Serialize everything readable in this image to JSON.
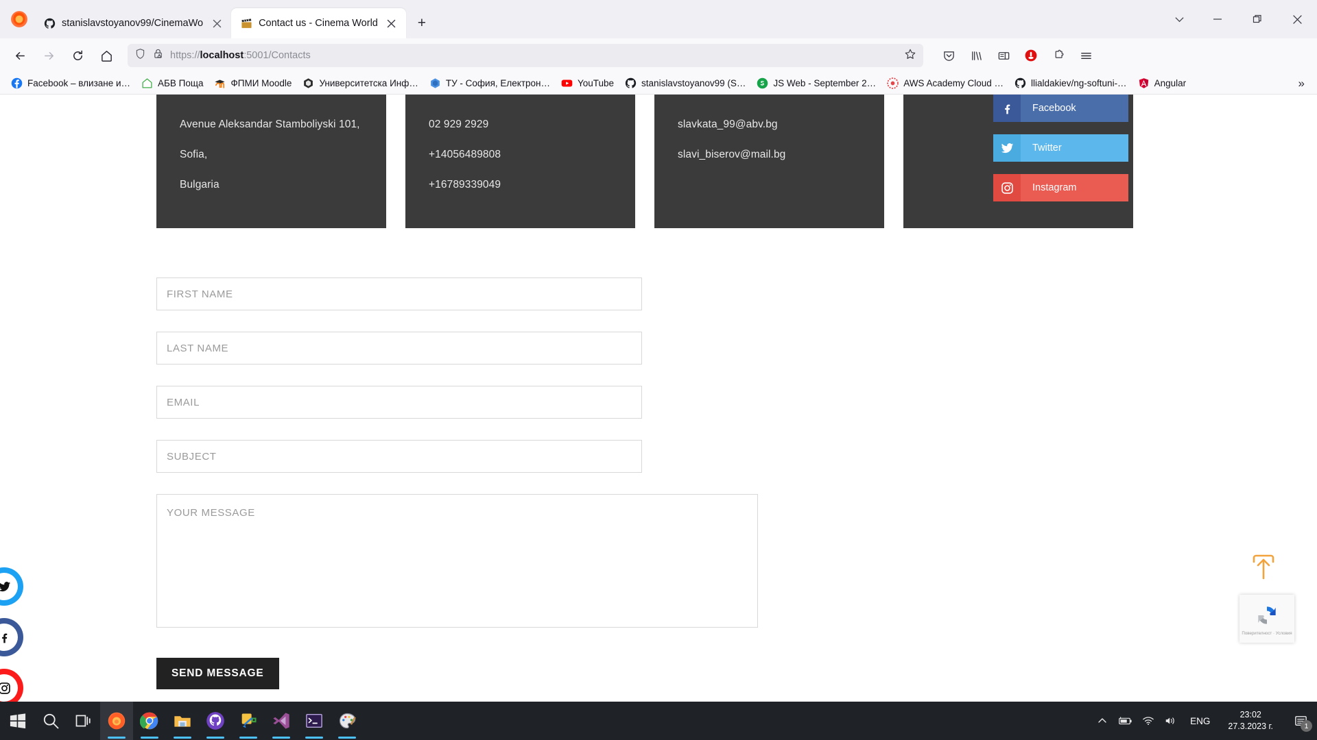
{
  "browser": {
    "app_icon": "firefox-logo-icon",
    "tabs": [
      {
        "title": "stanislavstoyanov99/CinemaWo",
        "favicon": "github-icon",
        "active": false
      },
      {
        "title": "Contact us - Cinema World",
        "favicon": "clapperboard-icon",
        "active": true
      }
    ],
    "new_tab_label": "+",
    "window_controls": {
      "list_all_tabs": "chevron-down-icon",
      "minimize": "—",
      "maximize": "❐",
      "close": "✕"
    },
    "nav": {
      "back": "back-arrow-icon",
      "forward": "forward-arrow-icon",
      "reload": "reload-icon",
      "home": "home-icon"
    },
    "urlbar": {
      "shield": "shield-icon",
      "lock": "lock-warning-icon",
      "scheme": "https://",
      "host": "localhost",
      "path": ":5001/Contacts",
      "full_url": "https://localhost:5001/Contacts",
      "bookmark_star": "star-icon"
    },
    "toolbar_right": [
      "pocket-icon",
      "library-icon",
      "sidebar-icon",
      "adblock-icon",
      "extensions-icon",
      "app-menu-icon"
    ],
    "bookmarks": [
      {
        "label": "Facebook – влизане и…",
        "icon": "facebook-icon"
      },
      {
        "label": "АБВ Поща",
        "icon": "abv-icon"
      },
      {
        "label": "ФПМИ Moodle",
        "icon": "moodle-icon"
      },
      {
        "label": "Университетска Инф…",
        "icon": "tu-icon"
      },
      {
        "label": "ТУ - София, Електрон…",
        "icon": "tu-blue-icon"
      },
      {
        "label": "YouTube",
        "icon": "youtube-icon"
      },
      {
        "label": "stanislavstoyanov99 (S…",
        "icon": "github-icon"
      },
      {
        "label": "JS Web - September 2…",
        "icon": "softuni-icon"
      },
      {
        "label": "AWS Academy Cloud …",
        "icon": "aws-icon"
      },
      {
        "label": "llialdakiev/ng-softuni-…",
        "icon": "github-icon"
      },
      {
        "label": "Angular",
        "icon": "angular-icon"
      }
    ],
    "bookmarks_overflow": "»"
  },
  "page": {
    "cards": [
      {
        "name": "address-card",
        "lines": [
          "Avenue Aleksandar Stamboliyski 101,",
          "Sofia,",
          "Bulgaria"
        ]
      },
      {
        "name": "phone-card",
        "lines": [
          "02 929 2929",
          "+14056489808",
          "+16789339049"
        ]
      },
      {
        "name": "email-card",
        "lines": [
          "slavkata_99@abv.bg",
          "slavi_biserov@mail.bg"
        ]
      }
    ],
    "social_buttons": [
      {
        "label": "Facebook",
        "icon": "facebook-icon",
        "color": "#3b5998"
      },
      {
        "label": "Twitter",
        "icon": "twitter-icon",
        "color": "#4aabe0"
      },
      {
        "label": "Instagram",
        "icon": "instagram-icon",
        "color": "#e04a41"
      }
    ],
    "form": {
      "fields": [
        {
          "name": "first-name-input",
          "placeholder": "FIRST NAME",
          "value": ""
        },
        {
          "name": "last-name-input",
          "placeholder": "LAST NAME",
          "value": ""
        },
        {
          "name": "email-input",
          "placeholder": "EMAIL",
          "value": ""
        },
        {
          "name": "subject-input",
          "placeholder": "SUBJECT",
          "value": ""
        }
      ],
      "message": {
        "name": "message-textarea",
        "placeholder": "YOUR MESSAGE",
        "value": ""
      },
      "submit_label": "SEND MESSAGE"
    },
    "social_rail": [
      {
        "icon": "twitter-icon",
        "color": "#1da1f2"
      },
      {
        "icon": "facebook-icon",
        "color": "#3b5998"
      },
      {
        "icon": "instagram-icon",
        "color": "#fb1b1b"
      }
    ],
    "scroll_top_icon": "scroll-to-top-arrow-icon",
    "recaptcha": {
      "icon": "recaptcha-icon",
      "text": "Поверителност · Условия"
    }
  },
  "taskbar": {
    "items": [
      {
        "name": "start-button",
        "icon": "windows-logo-icon"
      },
      {
        "name": "search-button",
        "icon": "search-icon"
      },
      {
        "name": "task-view-button",
        "icon": "task-view-icon"
      },
      {
        "name": "firefox-taskbar-item",
        "icon": "firefox-icon",
        "active": true,
        "running": true
      },
      {
        "name": "chrome-taskbar-item",
        "icon": "chrome-icon",
        "running": true
      },
      {
        "name": "file-explorer-taskbar-item",
        "icon": "folder-icon",
        "running": true
      },
      {
        "name": "github-desktop-taskbar-item",
        "icon": "github-icon",
        "running": true
      },
      {
        "name": "postman-taskbar-item",
        "icon": "postman-icon",
        "running": true
      },
      {
        "name": "visual-studio-taskbar-item",
        "icon": "visual-studio-icon",
        "running": true
      },
      {
        "name": "terminal-taskbar-item",
        "icon": "terminal-icon",
        "running": true
      },
      {
        "name": "paint-taskbar-item",
        "icon": "paint-icon",
        "running": true
      }
    ],
    "tray": {
      "chevron": "show-hidden-icons-icon",
      "battery": "battery-icon",
      "wifi": "wifi-icon",
      "volume": "volume-icon",
      "language": "ENG",
      "time": "23:02",
      "date": "27.3.2023 г.",
      "notification_icon": "notifications-icon",
      "notification_count": "1"
    }
  }
}
